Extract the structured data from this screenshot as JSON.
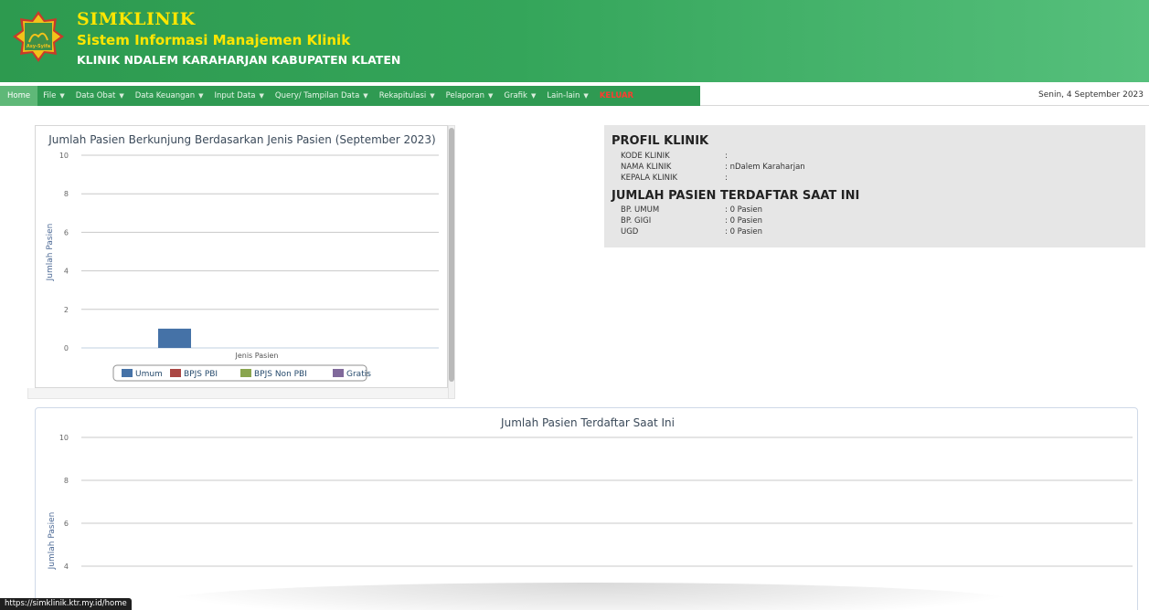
{
  "header": {
    "app_title": "SIMKLINIK",
    "app_subtitle": "Sistem Informasi Manajemen Klinik",
    "clinic_name": "KLINIK NDALEM KARAHARJAN KABUPATEN KLATEN",
    "logo_text": "Asy-Syifa"
  },
  "menu": {
    "items": [
      {
        "label": "Home"
      },
      {
        "label": "File"
      },
      {
        "label": "Data Obat"
      },
      {
        "label": "Data Keuangan"
      },
      {
        "label": "Input Data"
      },
      {
        "label": "Query/ Tampilan Data"
      },
      {
        "label": "Rekapitulasi"
      },
      {
        "label": "Pelaporan"
      },
      {
        "label": "Grafik"
      },
      {
        "label": "Lain-lain"
      },
      {
        "label": "KELUAR"
      }
    ],
    "date": "Senin, 4 September 2023"
  },
  "profile": {
    "title": "PROFIL KLINIK",
    "rows": [
      {
        "label": "KODE KLINIK",
        "value": ":"
      },
      {
        "label": "NAMA KLINIK",
        "value": ": nDalem Karaharjan"
      },
      {
        "label": "KEPALA KLINIK",
        "value": ":"
      }
    ],
    "patients_title": "JUMLAH PASIEN TERDAFTAR SAAT INI",
    "patient_rows": [
      {
        "label": "BP. UMUM",
        "value": ": 0 Pasien"
      },
      {
        "label": "BP. GIGI",
        "value": ": 0 Pasien"
      },
      {
        "label": "UGD",
        "value": ": 0 Pasien"
      }
    ]
  },
  "status_url": "https://simklinik.ktr.my.id/home",
  "chart_data": [
    {
      "type": "bar",
      "title": "Jumlah Pasien Berkunjung Berdasarkan Jenis Pasien (September 2023)",
      "xlabel": "Jenis Pasien",
      "ylabel": "Jumlah Pasien",
      "ylim": [
        0,
        10
      ],
      "yticks": [
        0,
        2,
        4,
        6,
        8,
        10
      ],
      "grid": true,
      "legend_position": "bottom",
      "series": [
        {
          "name": "Umum",
          "color": "#4572A7",
          "values": [
            1
          ]
        },
        {
          "name": "BPJS PBI",
          "color": "#AA4643",
          "values": [
            0
          ]
        },
        {
          "name": "BPJS Non PBI",
          "color": "#89A54E",
          "values": [
            0
          ]
        },
        {
          "name": "Gratis",
          "color": "#80699B",
          "values": [
            0
          ]
        }
      ]
    },
    {
      "type": "bar",
      "title": "Jumlah Pasien Terdaftar Saat Ini",
      "ylabel": "Jumlah Pasien",
      "ylim": [
        0,
        10
      ],
      "yticks_visible": [
        4,
        6,
        8,
        10
      ],
      "grid": true,
      "series": []
    }
  ]
}
